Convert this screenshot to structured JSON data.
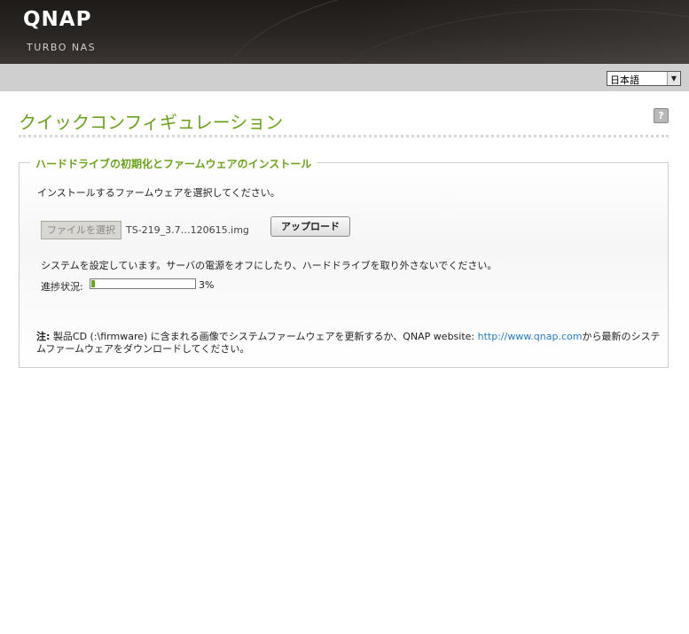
{
  "header": {
    "logo": "QNAP",
    "tagline": "TURBO NAS"
  },
  "language": {
    "selected": "日本語"
  },
  "page": {
    "title": "クイックコンフィギュレーション"
  },
  "panel": {
    "legend": "ハードドライブの初期化とファームウェアのインストール",
    "instruction": "インストールするファームウェアを選択してください。",
    "file_button_label": "ファイルを選択",
    "file_name": "TS-219_3.7…120615.img",
    "upload_button_label": "アップロード",
    "status_message": "システムを設定しています。サーバの電源をオフにしたり、ハードドライブを取り外さないでください。",
    "progress_label": "進捗状況:",
    "progress_percent": 3,
    "progress_text": "3%",
    "note_label": "注:",
    "note_text_1": " 製品CD (:\\firmware) に含まれる画像でシステムファームウェアを更新するか、QNAP website: ",
    "note_link": "http://www.qnap.com",
    "note_text_2": "から最新のシステムファームウェアをダウンロードしてください。"
  },
  "colors": {
    "accent_green": "#6aa21e",
    "progress_green": "#5fa81c",
    "link_blue": "#2a7bbd"
  }
}
